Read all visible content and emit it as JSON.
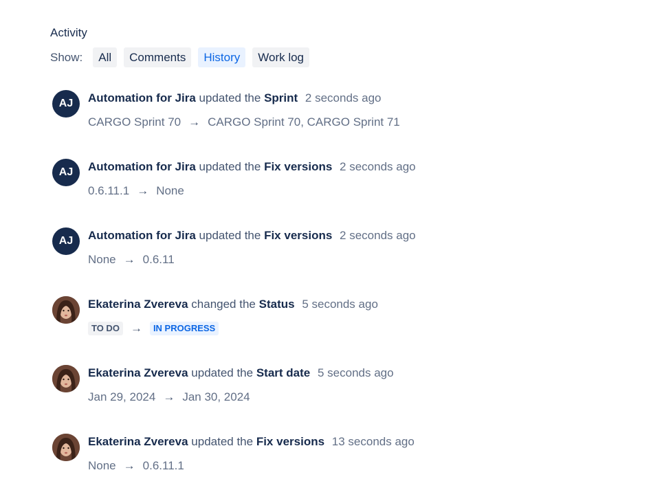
{
  "activity": {
    "title": "Activity",
    "show_label": "Show:",
    "filters": [
      {
        "label": "All"
      },
      {
        "label": "Comments"
      },
      {
        "label": "History",
        "active": true
      },
      {
        "label": "Work log"
      }
    ]
  },
  "entries": [
    {
      "avatar_initials": "AJ",
      "actor": "Automation for Jira",
      "action": "updated the",
      "field": "Sprint",
      "time": "2 seconds ago",
      "from": "CARGO Sprint 70",
      "arrow": "→",
      "to": "CARGO Sprint 70, CARGO Sprint 71"
    },
    {
      "avatar_initials": "AJ",
      "actor": "Automation for Jira",
      "action": "updated the",
      "field": "Fix versions",
      "time": "2 seconds ago",
      "from": "0.6.11.1",
      "arrow": "→",
      "to": "None"
    },
    {
      "avatar_initials": "AJ",
      "actor": "Automation for Jira",
      "action": "updated the",
      "field": "Fix versions",
      "time": "2 seconds ago",
      "from": "None",
      "arrow": "→",
      "to": "0.6.11"
    },
    {
      "actor": "Ekaterina Zvereva",
      "action": "changed the",
      "field": "Status",
      "time": "5 seconds ago",
      "from": "TO DO",
      "arrow": "→",
      "to": "IN PROGRESS"
    },
    {
      "actor": "Ekaterina Zvereva",
      "action": "updated the",
      "field": "Start date",
      "time": "5 seconds ago",
      "from": "Jan 29, 2024",
      "arrow": "→",
      "to": "Jan 30, 2024"
    },
    {
      "actor": "Ekaterina Zvereva",
      "action": "updated the",
      "field": "Fix versions",
      "time": "13 seconds ago",
      "from": "None",
      "arrow": "→",
      "to": "0.6.11.1"
    }
  ],
  "colors": {
    "avatar_bg": "#172b4d",
    "active_tab_bg": "#e9f2ff",
    "active_tab_text": "#0c66e4",
    "tab_bg": "#f1f2f4",
    "in_progress_bg": "#e9f2ff",
    "in_progress_text": "#0c66e4",
    "todo_bg": "#f1f2f4",
    "todo_text": "#44546f"
  },
  "icons": {
    "avatar_photo": "user-photo-avatar"
  }
}
